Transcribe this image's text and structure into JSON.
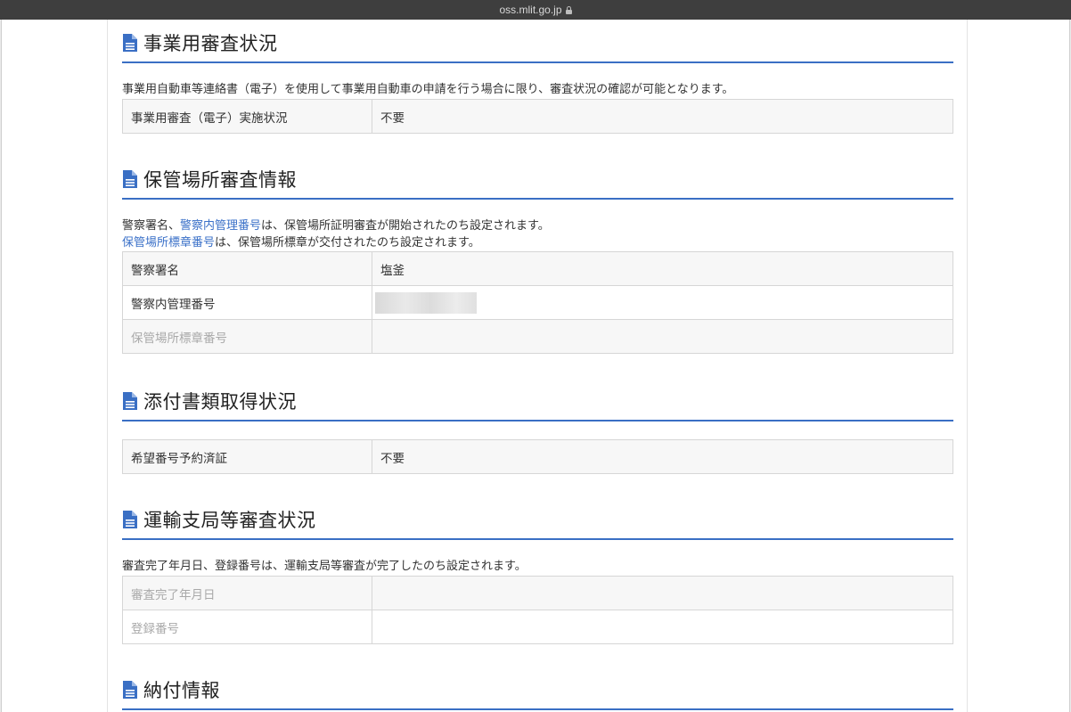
{
  "browser": {
    "url": "oss.mlit.go.jp"
  },
  "sections": {
    "business_review": {
      "title": "事業用審査状況",
      "note": "事業用自動車等連絡書（電子）を使用して事業用自動車の申請を行う場合に限り、審査状況の確認が可能となります。",
      "rows": [
        {
          "label": "事業用審査（電子）実施状況",
          "value": "不要"
        }
      ]
    },
    "storage_review": {
      "title": "保管場所審査情報",
      "note1_prefix": "警察署名、",
      "note1_link": "警察内管理番号",
      "note1_suffix": "は、保管場所証明審査が開始されたのち設定されます。",
      "note2_link": "保管場所標章番号",
      "note2_suffix": "は、保管場所標章が交付されたのち設定されます。",
      "rows": [
        {
          "label": "警察署名",
          "value": "塩釜"
        },
        {
          "label": "警察内管理番号",
          "value": ""
        },
        {
          "label": "保管場所標章番号",
          "value": ""
        }
      ]
    },
    "attachments": {
      "title": "添付書類取得状況",
      "rows": [
        {
          "label": "希望番号予約済証",
          "value": "不要"
        }
      ]
    },
    "transport_review": {
      "title": "運輸支局等審査状況",
      "note": "審査完了年月日、登録番号は、運輸支局等審査が完了したのち設定されます。",
      "rows": [
        {
          "label": "審査完了年月日",
          "value": ""
        },
        {
          "label": "登録番号",
          "value": ""
        }
      ]
    },
    "payment": {
      "title": "納付情報"
    }
  },
  "colors": {
    "accent": "#3a6fc4",
    "link": "#3a70c8",
    "muted_label": "#a9a9a9"
  },
  "icons": {
    "section_icon": "document-icon",
    "url_icon": "lock-icon"
  }
}
